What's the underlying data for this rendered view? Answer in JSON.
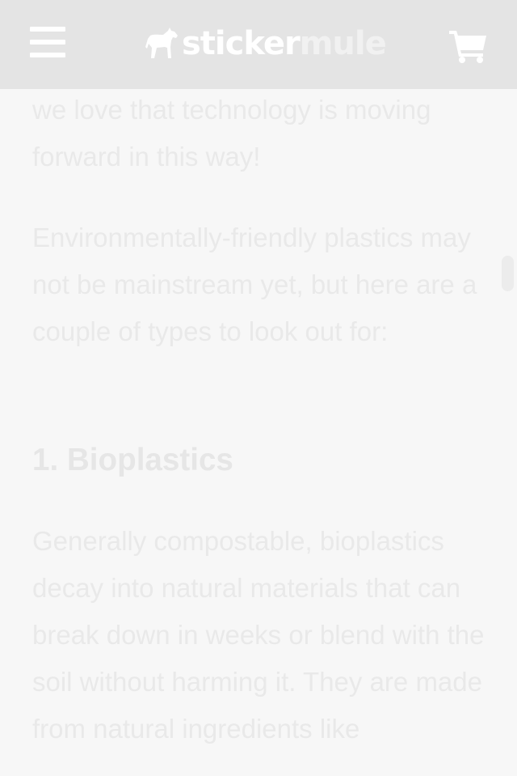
{
  "header": {
    "logo_part1": "sticker",
    "logo_part2": "mule"
  },
  "article": {
    "paragraph1": "we love that technology is moving forward in this way!",
    "paragraph2": "Environmentally-friendly plastics may not be mainstream yet, but here are a couple of types to look out for:",
    "heading": "1. Bioplastics",
    "paragraph3": "Generally compostable, bioplastics decay into natural materials that can break down in weeks or blend with the soil without harming it. They are made from natural ingredients like"
  },
  "colors": {
    "header_bg": "#e4e4e4",
    "page_bg": "#f7f7f7",
    "text": "#e9e9e9",
    "icon": "#ffffff"
  },
  "icons": {
    "menu": "hamburger-icon",
    "logo": "mule-icon",
    "cart": "cart-icon"
  }
}
